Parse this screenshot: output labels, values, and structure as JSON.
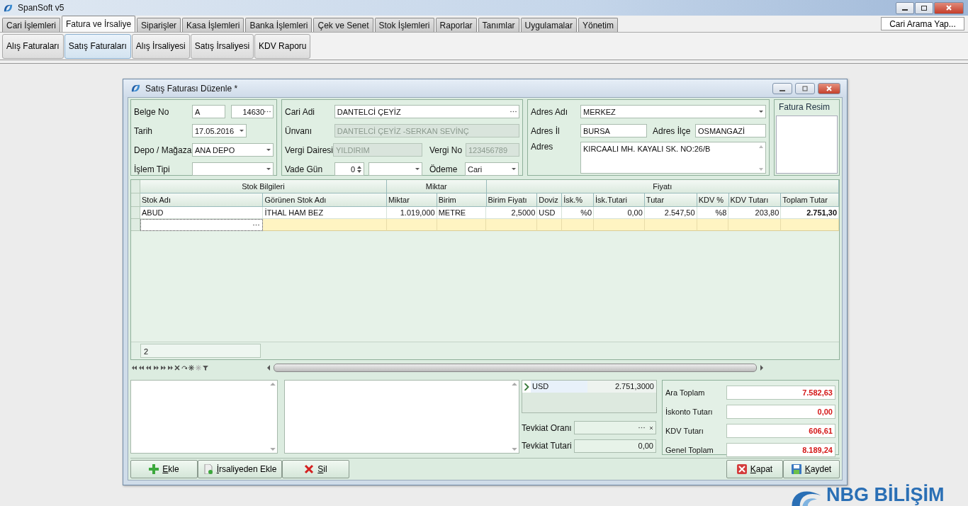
{
  "app": {
    "title": "SpanSoft v5"
  },
  "main_tabs": [
    {
      "label": "Cari İşlemleri",
      "selected": false
    },
    {
      "label": "Fatura ve İrsaliye",
      "selected": true
    },
    {
      "label": "Siparişler",
      "selected": false
    },
    {
      "label": "Kasa İşlemleri",
      "selected": false
    },
    {
      "label": "Banka İşlemleri",
      "selected": false
    },
    {
      "label": "Çek ve Senet",
      "selected": false
    },
    {
      "label": "Stok İşlemleri",
      "selected": false
    },
    {
      "label": "Raporlar",
      "selected": false
    },
    {
      "label": "Tanımlar",
      "selected": false
    },
    {
      "label": "Uygulamalar",
      "selected": false
    },
    {
      "label": "Yönetim",
      "selected": false
    }
  ],
  "search_button": "Cari Arama Yap...",
  "sub_tabs": [
    {
      "label": "Alış Faturaları",
      "selected": false
    },
    {
      "label": "Satış Faturaları",
      "selected": true
    },
    {
      "label": "Alış İrsaliyesi",
      "selected": false
    },
    {
      "label": "Satış İrsaliyesi",
      "selected": false
    },
    {
      "label": "KDV Raporu",
      "selected": false
    }
  ],
  "background_logo": {
    "text": "NBG BİLİŞİM"
  },
  "dialog": {
    "title": "Satış Faturası Düzenle *",
    "belge_no": {
      "label": "Belge No",
      "series": "A",
      "number": "14630"
    },
    "tarih": {
      "label": "Tarih",
      "value": "17.05.2016"
    },
    "depo": {
      "label": "Depo / Mağaza",
      "value": "ANA DEPO"
    },
    "islem_tipi": {
      "label": "İşlem Tipi"
    },
    "cari_adi": {
      "label": "Cari Adi",
      "value": "DANTELCİ ÇEYİZ"
    },
    "unvani": {
      "label": "Ünvanı",
      "value": "DANTELCİ ÇEYİZ -SERKAN SEVİNÇ",
      "disabled": true
    },
    "vergi_dairesi": {
      "label": "Vergi Dairesi",
      "value": "YILDIRIM",
      "disabled": true
    },
    "vergi_no": {
      "label": "Vergi No",
      "value": "123456789",
      "disabled": true
    },
    "vade_gun": {
      "label": "Vade Gün",
      "value": "0"
    },
    "odeme": {
      "label": "Ödeme",
      "value": "Cari"
    },
    "adres_adi": {
      "label": "Adres Adı",
      "value": "MERKEZ"
    },
    "adres_il": {
      "label": "Adres İl",
      "value": "BURSA"
    },
    "adres_ilce": {
      "label": "Adres İlçe",
      "value": "OSMANGAZİ"
    },
    "adres": {
      "label": "Adres",
      "value": "KIRCAALI MH. KAYALI SK. NO:26/B"
    },
    "fatura_resim": {
      "title": "Fatura Resim"
    },
    "grid": {
      "groups": [
        {
          "label": "Stok Bilgileri",
          "columns": [
            "Stok Adı",
            "Görünen Stok Adı"
          ]
        },
        {
          "label": "Miktar",
          "columns": [
            "Miktar",
            "Birim"
          ]
        },
        {
          "label": "Fiyatı",
          "columns": [
            "Birim Fiyatı",
            "Doviz",
            "İsk.%",
            "İsk.Tutari",
            "Tutar",
            "KDV %",
            "KDV Tutarı",
            "Toplam Tutar"
          ]
        }
      ],
      "rows": [
        [
          "ABUD",
          "İTHAL HAM BEZ",
          "1.019,000",
          "METRE",
          "2,5000",
          "USD",
          "%0",
          "0,00",
          "2.547,50",
          "%8",
          "203,80",
          "2.751,30"
        ]
      ],
      "footer_count": "2"
    },
    "currency": {
      "code": "USD",
      "amount": "2.751,3000"
    },
    "tevkiat_orani": {
      "label": "Tevkiat Oranı"
    },
    "tevkiat_tutari": {
      "label": "Tevkiat Tutari",
      "value": "0,00"
    },
    "totals": [
      {
        "label": "Ara Toplam",
        "value": "7.582,63"
      },
      {
        "label": "İskonto Tutarı",
        "value": "0,00"
      },
      {
        "label": "KDV Tutarı",
        "value": "606,61"
      },
      {
        "label": "Genel Toplam",
        "value": "8.189,24"
      }
    ],
    "buttons_left": [
      {
        "label": "Ekle",
        "kind": "add"
      },
      {
        "label": "İrsaliyeden Ekle",
        "kind": "import"
      },
      {
        "label": "Sil",
        "kind": "delete"
      }
    ],
    "buttons_right": [
      {
        "label": "Kapat",
        "kind": "close"
      },
      {
        "label": "Kaydet",
        "kind": "save"
      }
    ]
  }
}
